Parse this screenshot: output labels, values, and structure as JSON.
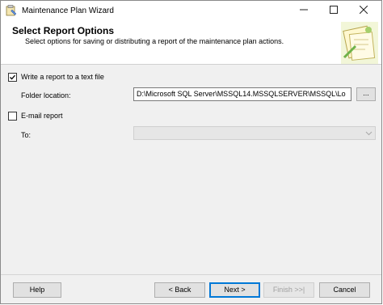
{
  "window": {
    "title": "Maintenance Plan Wizard"
  },
  "header": {
    "title": "Select Report Options",
    "subtitle": "Select options for saving or distributing a report of the maintenance plan actions."
  },
  "options": {
    "write_report": {
      "label": "Write a report to a text file",
      "checked": true
    },
    "folder_location": {
      "label": "Folder location:",
      "value": "D:\\Microsoft SQL Server\\MSSQL14.MSSQLSERVER\\MSSQL\\Lo",
      "browse_label": "..."
    },
    "email_report": {
      "label": "E-mail report",
      "checked": false
    },
    "to": {
      "label": "To:",
      "value": ""
    }
  },
  "footer": {
    "help_label": "Help",
    "back_label": "< Back",
    "next_label": "Next >",
    "finish_label": "Finish >>|",
    "cancel_label": "Cancel"
  },
  "icons": {
    "app": "wizard-app-icon",
    "header": "maintenance-plan-graphic"
  }
}
